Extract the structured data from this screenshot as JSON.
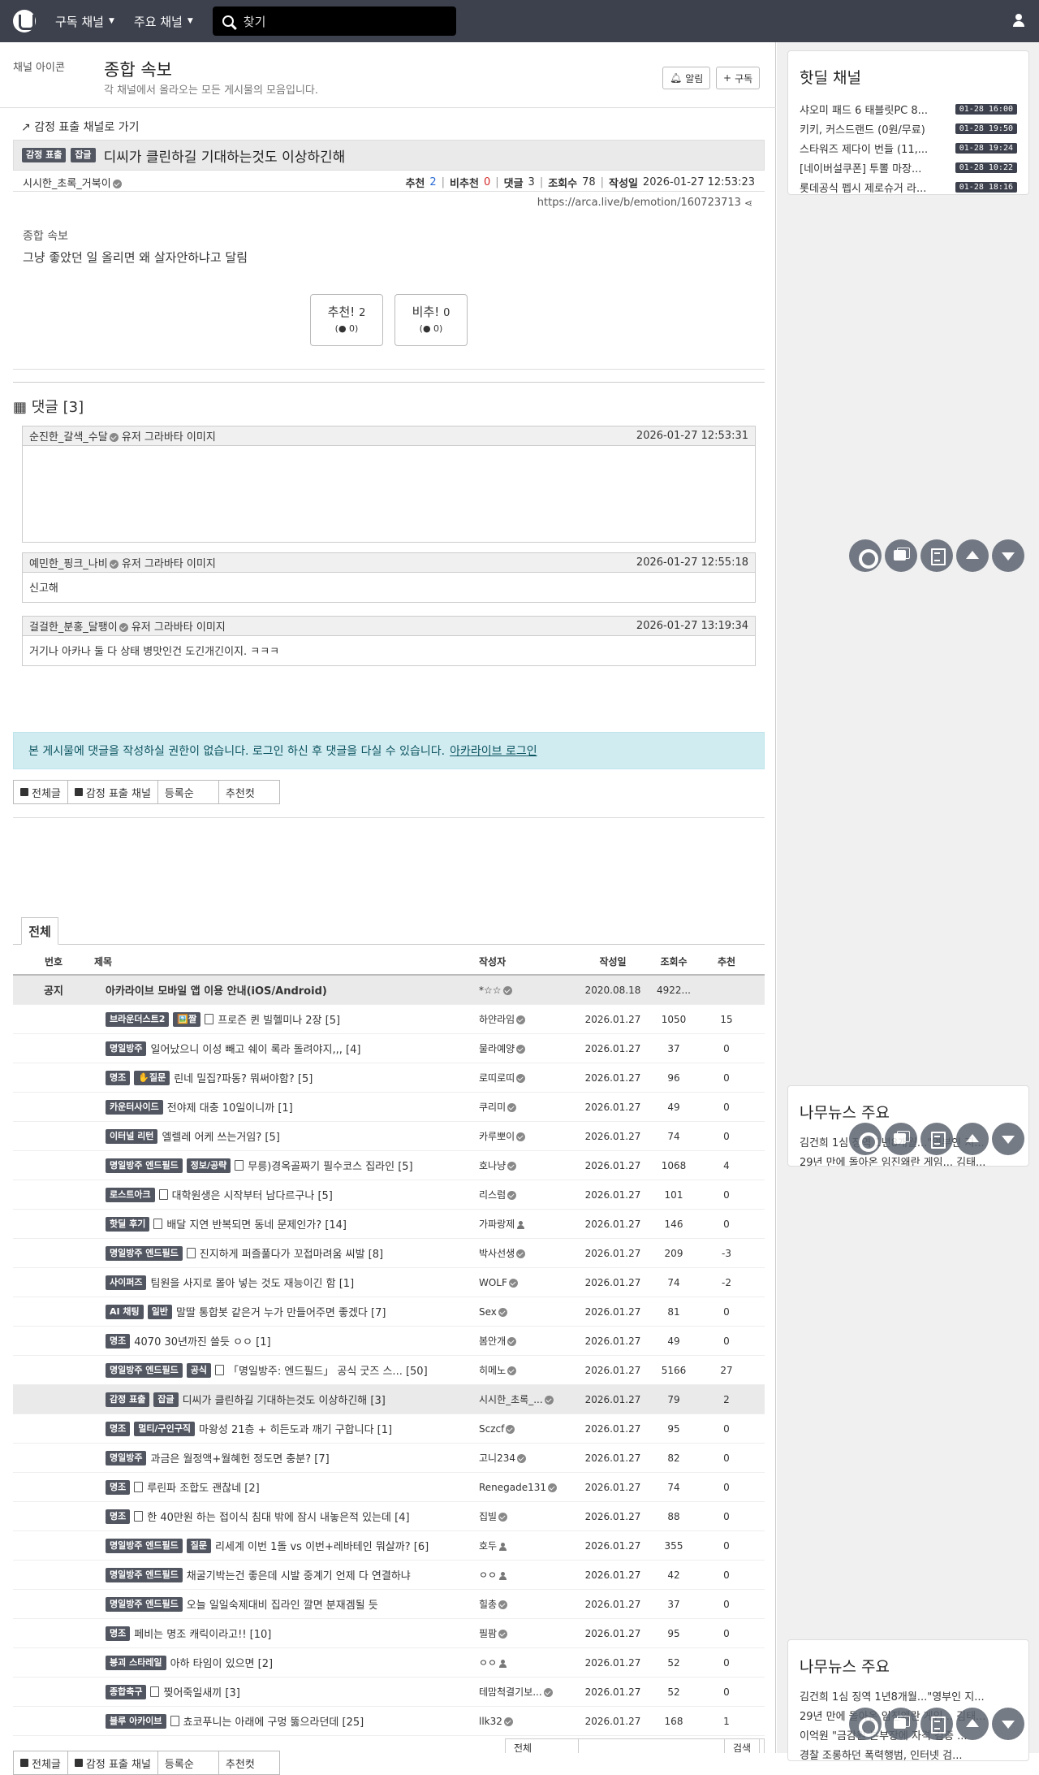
{
  "nav": {
    "subscribed": "구독 채널",
    "major": "주요 채널",
    "search_placeholder": "찾기"
  },
  "board": {
    "icon_alt": "채널 아이콘",
    "title": "종합 속보",
    "desc": "각 채널에서 올라오는 모든 게시물의 모음입니다.",
    "alarm_label": "알림",
    "subscribe_label": "구독"
  },
  "post": {
    "back_link": "감정 표출 채널로 가기",
    "badge1": "감정 표출",
    "badge2": "잡글",
    "title": "디씨가 클린하길 기대하는것도 이상하긴해",
    "author": "시시한_초록_거북이",
    "rec_label": "추천",
    "rec": "2",
    "unrec_label": "비추천",
    "unrec": "0",
    "cmt_label": "댓글",
    "cmt": "3",
    "view_label": "조회수",
    "views": "78",
    "date_label": "작성일",
    "date": "2026-01-27 12:53:23",
    "url": "https://arca.live/b/emotion/160723713",
    "img_alt": "종합 속보",
    "body": "그냥 좋았던 일 올리면 왜 살자안하냐고 달림",
    "vote_up": "추천!",
    "vote_up_cnt": "2",
    "vote_up_sub": "0",
    "vote_down": "비추!",
    "vote_down_cnt": "0",
    "vote_down_sub": "0"
  },
  "comments_header": "댓글 [3]",
  "comments": [
    {
      "name": "순진한_갈색_수달",
      "avatar": "유저 그라바타 이미지",
      "time": "2026-01-27 12:53:31",
      "body": ""
    },
    {
      "name": "예민한_핑크_나비",
      "avatar": "유저 그라바타 이미지",
      "time": "2026-01-27 12:55:18",
      "body": "신고해"
    },
    {
      "name": "걸걸한_분홍_달팽이",
      "avatar": "유저 그라바타 이미지",
      "time": "2026-01-27 13:19:34",
      "body": "거기나 아카나 둘 다 상태 병맛인건 도긴개긴이지. ㅋㅋㅋ"
    }
  ],
  "alert": {
    "text": "본 게시물에 댓글을 작성하실 권한이 없습니다. 로그인 하신 후 댓글을 다실 수 있습니다.",
    "link": "아카라이브 로그인"
  },
  "buttons": {
    "all": "전체글",
    "channel": "감정 표출 채널",
    "order": "등록순",
    "best": "추천컷"
  },
  "tab_all": "전체",
  "table": {
    "headers": {
      "num": "번호",
      "title": "제목",
      "author": "작성자",
      "date": "작성일",
      "views": "조회수",
      "rec": "추천"
    },
    "notice": {
      "num": "공지",
      "title": "아카라이브 모바일 앱 이용 안내(iOS/Android)",
      "author": "*☆☆",
      "date": "2020.08.18",
      "views": "4922...",
      "rec": ""
    },
    "rows": [
      {
        "badges": [
          "브라운더스트2",
          "🖼️짤"
        ],
        "doc": true,
        "title": "프로즌 퀸 빌헬미나 2장 [5]",
        "author": "하얀라임",
        "icon": "check",
        "date": "2026.01.27",
        "views": "1050",
        "rec": "15"
      },
      {
        "badges": [
          "명일방주"
        ],
        "doc": false,
        "title": "일어났으니 이성 빼고 쉐이 록라 돌려야지,,, [4]",
        "author": "물라예양",
        "icon": "check",
        "date": "2026.01.27",
        "views": "37",
        "rec": "0"
      },
      {
        "badges": [
          "명조",
          "✋질문"
        ],
        "doc": false,
        "title": "린네 밀집?파동? 뭐써야함? [5]",
        "author": "로띠로띠",
        "icon": "check",
        "date": "2026.01.27",
        "views": "96",
        "rec": "0"
      },
      {
        "badges": [
          "카운터사이드"
        ],
        "doc": false,
        "title": "전야제 대충 10일이니까 [1]",
        "author": "쿠리미",
        "icon": "check",
        "date": "2026.01.27",
        "views": "49",
        "rec": "0"
      },
      {
        "badges": [
          "이터널 리턴"
        ],
        "doc": false,
        "title": "엘렐레 어케 쓰는거임? [5]",
        "author": "카루뽀이",
        "icon": "check",
        "date": "2026.01.27",
        "views": "74",
        "rec": "0"
      },
      {
        "badges": [
          "명일방주 엔드필드",
          "정보/공략"
        ],
        "doc": true,
        "title": "무릉)경옥골짜기 필수코스 집라인 [5]",
        "author": "호나냥",
        "icon": "check",
        "date": "2026.01.27",
        "views": "1068",
        "rec": "4"
      },
      {
        "badges": [
          "로스트아크"
        ],
        "doc": true,
        "title": "대학원생은 시작부터 남다르구나 [5]",
        "author": "리스럼",
        "icon": "check",
        "date": "2026.01.27",
        "views": "101",
        "rec": "0"
      },
      {
        "badges": [
          "핫딜 후기"
        ],
        "doc": true,
        "title": "배달 지연 반복되면 동네 문제인가? [14]",
        "author": "가파랑제",
        "icon": "person",
        "date": "2026.01.27",
        "views": "146",
        "rec": "0"
      },
      {
        "badges": [
          "명일방주 엔드필드"
        ],
        "doc": true,
        "title": "진지하게 퍼즐풀다가 꼬접마려움 씨발 [8]",
        "author": "박사선생",
        "icon": "check",
        "date": "2026.01.27",
        "views": "209",
        "rec": "-3"
      },
      {
        "badges": [
          "사이퍼즈"
        ],
        "doc": false,
        "title": "팀원을 사지로 몰아 넣는 것도 재능이긴 함 [1]",
        "author": "WOLF",
        "icon": "check",
        "date": "2026.01.27",
        "views": "74",
        "rec": "-2"
      },
      {
        "badges": [
          "AI 채팅",
          "일반"
        ],
        "doc": false,
        "title": "말딸 통합봇 같은거 누가 만들어주면 좋겠다 [7]",
        "author": "Sex",
        "icon": "check",
        "date": "2026.01.27",
        "views": "81",
        "rec": "0"
      },
      {
        "badges": [
          "명조"
        ],
        "doc": false,
        "title": "4070 30년까진 쓸듯 ㅇㅇ [1]",
        "author": "봄안개",
        "icon": "check",
        "date": "2026.01.27",
        "views": "49",
        "rec": "0"
      },
      {
        "badges": [
          "명일방주 엔드필드",
          "공식"
        ],
        "doc": true,
        "title": "「명일방주: 엔드필드」 공식 굿즈 스... [50]",
        "author": "히메노",
        "icon": "check",
        "date": "2026.01.27",
        "views": "5166",
        "rec": "27"
      },
      {
        "badges": [
          "감정 표출",
          "잡글"
        ],
        "doc": false,
        "title": "디씨가 클린하길 기대하는것도 이상하긴해 [3]",
        "author": "시시한_초록_...",
        "icon": "check",
        "date": "2026.01.27",
        "views": "79",
        "rec": "2",
        "hl": true
      },
      {
        "badges": [
          "명조",
          "멀티/구인구직"
        ],
        "doc": false,
        "title": "마왕성 21층 + 히든도과 깨기 구합니다 [1]",
        "author": "Sczcf",
        "icon": "check",
        "date": "2026.01.27",
        "views": "95",
        "rec": "0"
      },
      {
        "badges": [
          "명일방주"
        ],
        "doc": false,
        "title": "과금은 월정액+월혜헌 정도면 충분? [7]",
        "author": "고니234",
        "icon": "check",
        "date": "2026.01.27",
        "views": "82",
        "rec": "0"
      },
      {
        "badges": [
          "명조"
        ],
        "doc": true,
        "title": "루린파 조합도 괜찮네 [2]",
        "author": "Renegade131",
        "icon": "check",
        "date": "2026.01.27",
        "views": "74",
        "rec": "0"
      },
      {
        "badges": [
          "명조"
        ],
        "doc": true,
        "title": "한 40만원 하는 접이식 침대 밖에 잠시 내놓은적 있는데 [4]",
        "author": "집빌",
        "icon": "check",
        "date": "2026.01.27",
        "views": "88",
        "rec": "0"
      },
      {
        "badges": [
          "명일방주 엔드필드",
          "질문"
        ],
        "doc": false,
        "title": "리세계 이번 1돌 vs 이번+레바테인 뭐살까? [6]",
        "author": "호두",
        "icon": "person",
        "date": "2026.01.27",
        "views": "355",
        "rec": "0"
      },
      {
        "badges": [
          "명일방주 엔드필드"
        ],
        "doc": false,
        "title": "채굴기박는건 좋은데 시발 중계기 언제 다 연결하냐",
        "author": "ㅇㅇ",
        "icon": "person",
        "date": "2026.01.27",
        "views": "42",
        "rec": "0"
      },
      {
        "badges": [
          "명일방주 엔드필드"
        ],
        "doc": false,
        "title": "오늘 일일숙제대비 집라인 깔면 분재겜될 듯",
        "author": "힐총",
        "icon": "check",
        "date": "2026.01.27",
        "views": "37",
        "rec": "0"
      },
      {
        "badges": [
          "명조"
        ],
        "doc": false,
        "title": "페비는 명조 캐릭이라고!! [10]",
        "author": "필팜",
        "icon": "check",
        "date": "2026.01.27",
        "views": "95",
        "rec": "0"
      },
      {
        "badges": [
          "붕괴 스타레일"
        ],
        "doc": false,
        "title": "아하 타임이 있으면 [2]",
        "author": "ㅇㅇ",
        "icon": "person",
        "date": "2026.01.27",
        "views": "52",
        "rec": "0"
      },
      {
        "badges": [
          "종합축구"
        ],
        "doc": true,
        "title": "찢어죽일새끼 [3]",
        "author": "테맘척결기보...",
        "icon": "check",
        "date": "2026.01.27",
        "views": "52",
        "rec": "0"
      },
      {
        "badges": [
          "블루 아카이브"
        ],
        "doc": true,
        "title": "쵸코푸니는 아래에 구멍 뚫으라던데 [25]",
        "author": "llk32",
        "icon": "check",
        "date": "2026.01.27",
        "views": "168",
        "rec": "1"
      }
    ]
  },
  "pager": {
    "a": "전체",
    "c": "검색"
  },
  "sidebar": {
    "hotdeal_title": "핫딜 채널",
    "hotdeal": [
      {
        "t": "샤오미 패드 6 태블릿PC 8...",
        "time": "01-28 16:00"
      },
      {
        "t": "키키, 커스드랜드 (0원/무료)",
        "time": "01-28 19:50"
      },
      {
        "t": "스타워즈 제다이 번들 (11,...",
        "time": "01-28 19:24"
      },
      {
        "t": "[네이버설쿠폰] 투뽈 마장...",
        "time": "01-28 10:22"
      },
      {
        "t": "롯데공식 펩시 제로슈거 라...",
        "time": "01-28 18:16"
      }
    ],
    "news_title": "나무뉴스 주요",
    "news1": [
      "김건희 1심 징역 1년8개월...\"영부인 지...",
      "29년 만에 돌아온 임진왜란 게임... 김태..."
    ],
    "news2": [
      "김건희 1심 징역 1년8개월...\"영부인 지...",
      "29년 만에 돌아온 임진왜란 게임... 김태...",
      "이억원 \"금감원 본부장에 자격 검증 ...",
      "경찰 조롱하던 폭력행범, 인터넷 검...  "
    ]
  }
}
